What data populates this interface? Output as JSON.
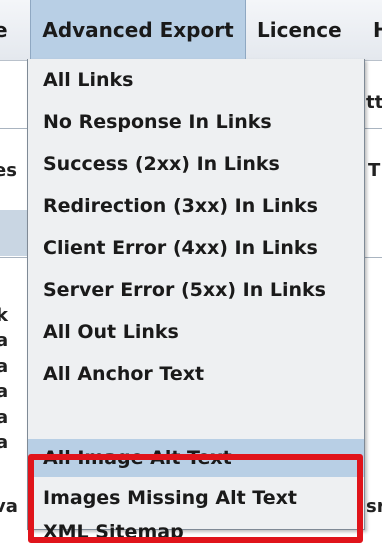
{
  "menubar": {
    "prev_fragment": "e",
    "active": "Advanced Export",
    "licence": "Licence",
    "next_fragment": "H"
  },
  "background": {
    "frag_tt": "tt",
    "frag_es": "es",
    "frag_T": "T",
    "left_frags": [
      "k",
      "a",
      "a",
      "a",
      "a",
      "a",
      "va"
    ],
    "right_frag_sr": "sr"
  },
  "menu": {
    "items": [
      "All Links",
      "No Response In Links",
      "Success (2xx) In Links",
      "Redirection (3xx) In Links",
      "Client Error (4xx) In Links",
      "Server Error (5xx) In Links",
      "All Out Links",
      "All Anchor Text",
      "All Image Alt Text",
      "Images Missing Alt Text",
      "XML Sitemap"
    ],
    "selected_index": 8
  },
  "colors": {
    "accent": "#b8cfe5",
    "highlight_box": "#e0141b"
  }
}
